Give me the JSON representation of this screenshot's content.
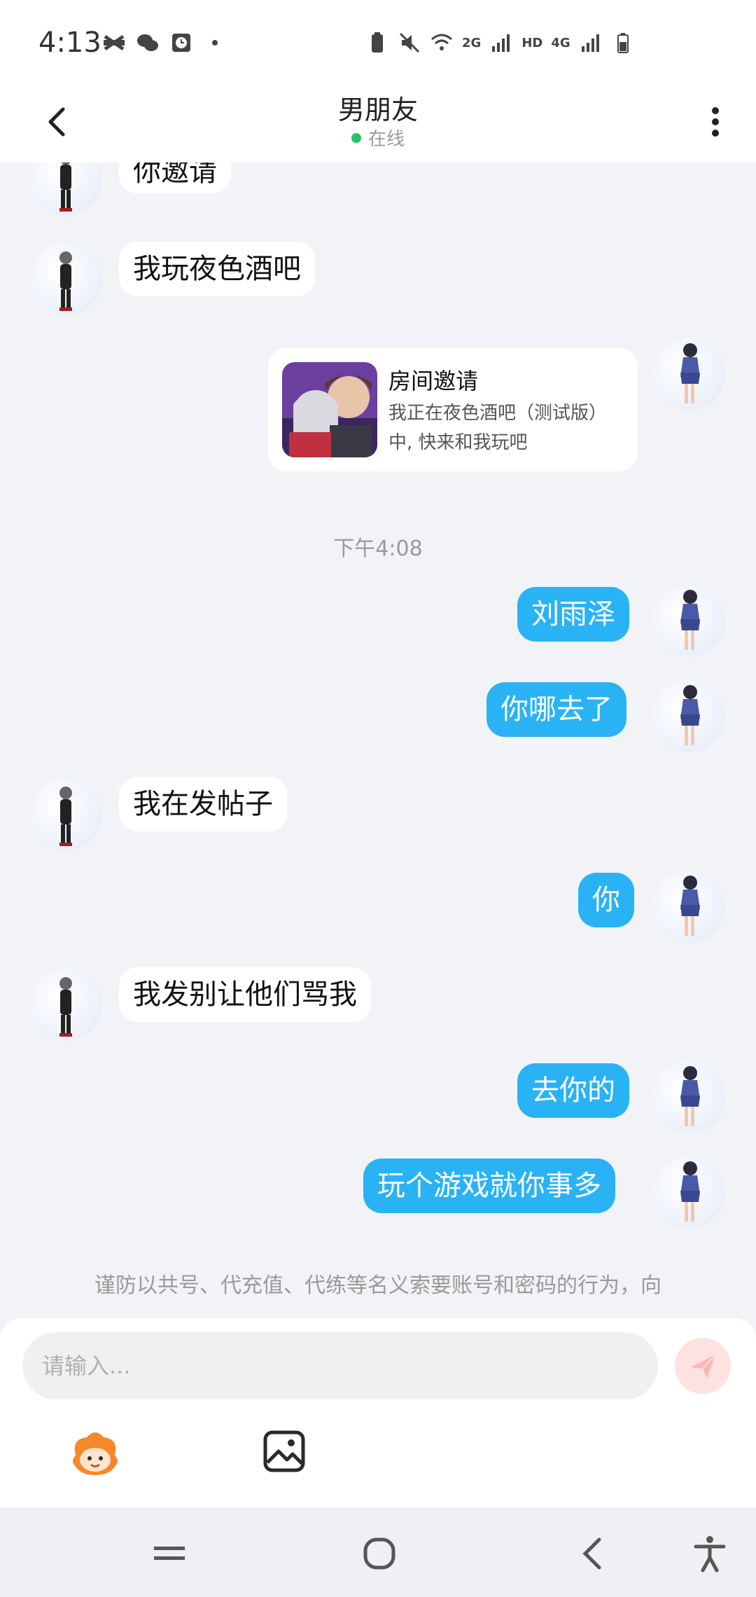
{
  "status_bar": {
    "time": "4:13",
    "hd": "HD",
    "net2g": "2G",
    "net4g": "4G"
  },
  "header": {
    "title": "男朋友",
    "status": "在线"
  },
  "messages": {
    "m1": "你邀请",
    "m2": "我玩夜色酒吧",
    "m3": "刘雨泽",
    "m4": "你哪去了",
    "m5": "我在发帖子",
    "m6": "你",
    "m7": "我发别让他们骂我",
    "m8": "去你的",
    "m9": "玩个游戏就你事多"
  },
  "invite_card": {
    "title": "房间邀请",
    "description": "我正在夜色酒吧（测试版）中, 快来和我玩吧"
  },
  "timestamp": "下午4:08",
  "notice": "谨防以共号、代充值、代练等名义索要账号和密码的行为，向",
  "input": {
    "placeholder": "请输入..."
  },
  "colors": {
    "accent": "#29b3f5",
    "online": "#22c55e",
    "send_disabled": "#fde2e2"
  }
}
